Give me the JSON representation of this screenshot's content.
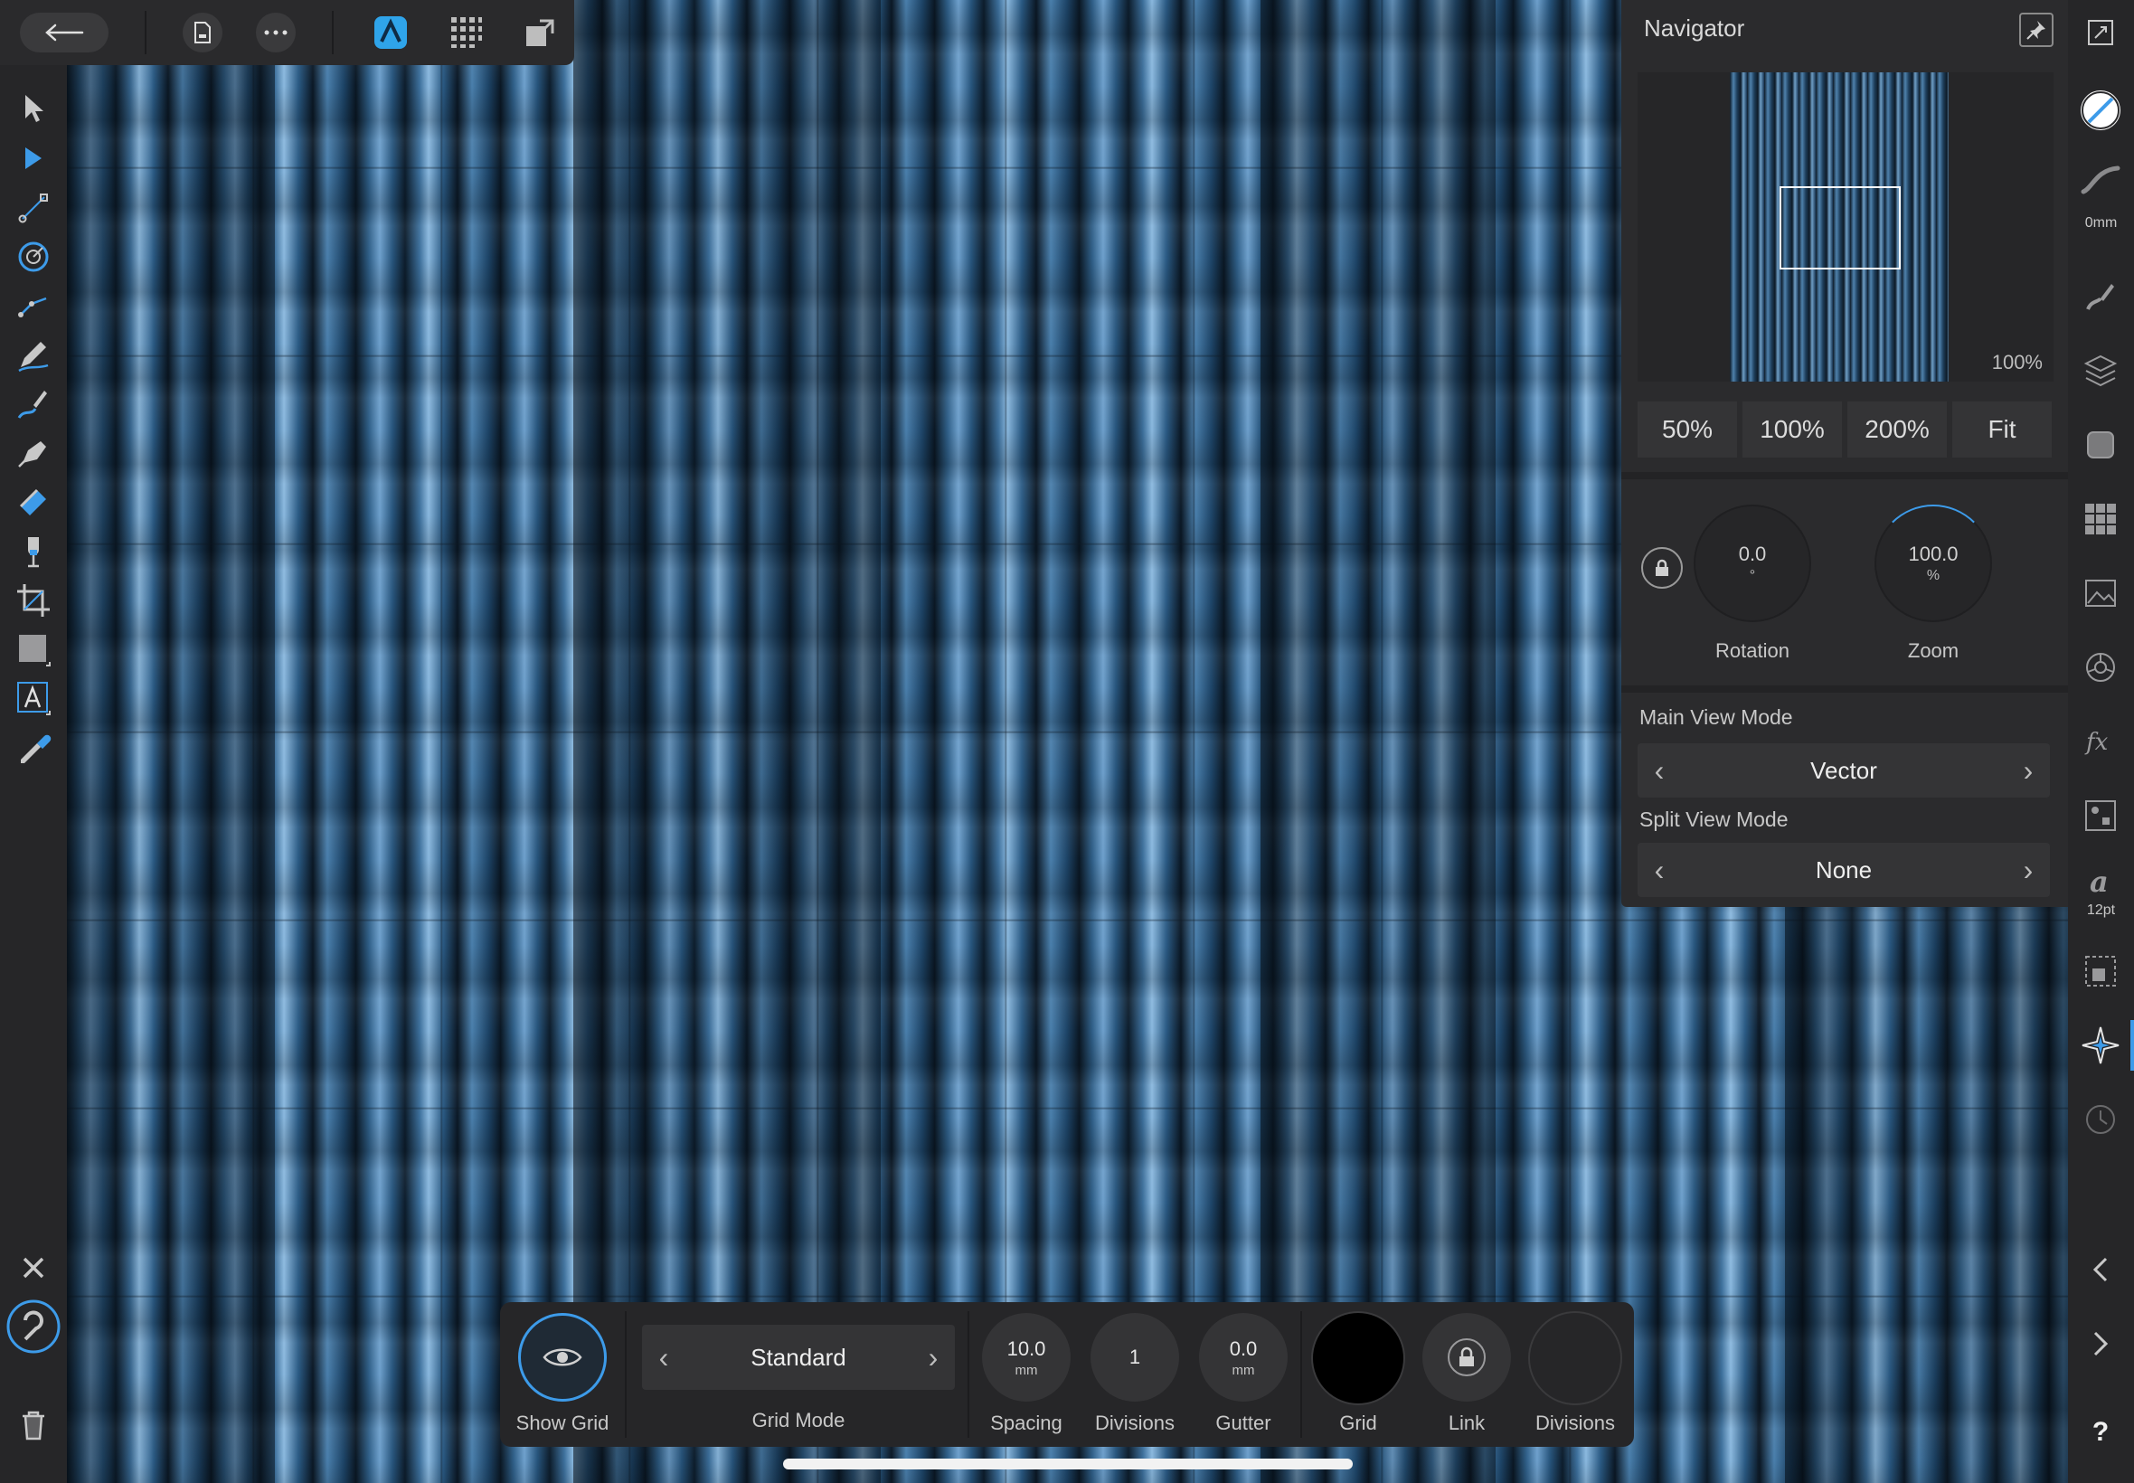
{
  "navigator": {
    "title": "Navigator",
    "preview_zoom": "100%",
    "zoom_buttons": [
      "50%",
      "100%",
      "200%",
      "Fit"
    ],
    "rotation": {
      "value": "0.0",
      "unit": "°",
      "label": "Rotation"
    },
    "zoom": {
      "value": "100.0",
      "unit": "%",
      "label": "Zoom"
    },
    "main_view_mode": {
      "label": "Main View Mode",
      "value": "Vector"
    },
    "split_view_mode": {
      "label": "Split View Mode",
      "value": "None"
    }
  },
  "right_bar": {
    "stroke_width_label": "0mm",
    "font_size_label": "12pt",
    "help_label": "?"
  },
  "grid_toolbar": {
    "show_grid_label": "Show Grid",
    "grid_mode": {
      "label": "Grid Mode",
      "value": "Standard"
    },
    "spacing": {
      "value": "10.0",
      "unit": "mm",
      "label": "Spacing"
    },
    "divisions": {
      "value": "1",
      "label": "Divisions"
    },
    "gutter": {
      "value": "0.0",
      "unit": "mm",
      "label": "Gutter"
    },
    "grid_color_label": "Grid",
    "link_label": "Link",
    "divisions_color_label": "Divisions"
  },
  "colors": {
    "accent": "#3d9be9",
    "panel_bg": "#2b2b2d",
    "toolbar_bg": "#262628"
  }
}
